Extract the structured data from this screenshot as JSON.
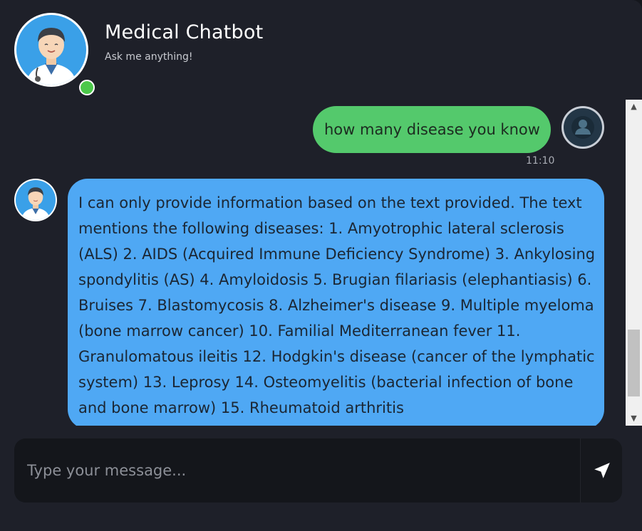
{
  "header": {
    "title": "Medical Chatbot",
    "subtitle": "Ask me anything!",
    "status": "online",
    "avatar_icon": "doctor-avatar-icon"
  },
  "messages": [
    {
      "sender": "user",
      "text": "how many disease you know",
      "time": "11:10",
      "avatar_icon": "user-avatar-icon"
    },
    {
      "sender": "bot",
      "text": "I can only provide information based on the text provided. The text mentions the following diseases: 1. Amyotrophic lateral sclerosis (ALS) 2. AIDS (Acquired Immune Deficiency Syndrome) 3. Ankylosing spondylitis (AS) 4. Amyloidosis 5. Brugian filariasis (elephantiasis) 6. Bruises 7. Blastomycosis 8. Alzheimer's disease 9. Multiple myeloma (bone marrow cancer) 10. Familial Mediterranean fever 11. Granulomatous ileitis 12. Hodgkin's disease (cancer of the lymphatic system) 13. Leprosy 14. Osteomyelitis (bacterial infection of bone and bone marrow) 15. Rheumatoid arthritis",
      "avatar_icon": "doctor-avatar-icon"
    }
  ],
  "composer": {
    "placeholder": "Type your message...",
    "value": "",
    "send_icon": "send-icon"
  },
  "colors": {
    "background": "#1e2029",
    "user_bubble": "#54c96c",
    "bot_bubble": "#4fa8f4",
    "online": "#4cc84a",
    "composer": "#14161b"
  }
}
